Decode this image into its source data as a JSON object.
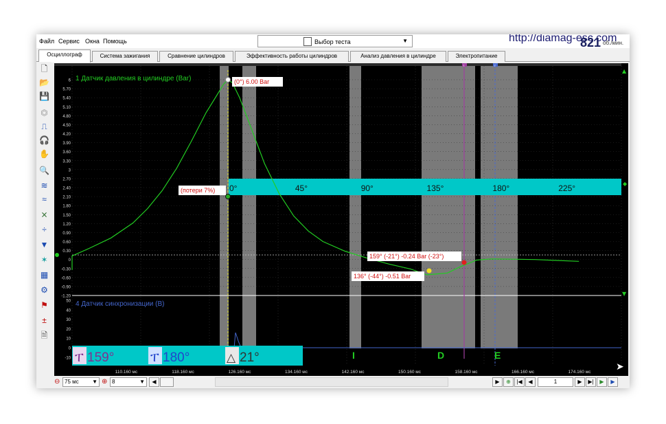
{
  "menu": {
    "file": "Файл",
    "service": "Сервис",
    "windows": "Окна",
    "help": "Помощь"
  },
  "test_selector": {
    "label": "Выбор теста"
  },
  "header": {
    "url": "http://diamag-esc.com",
    "rpm": "821",
    "rpm_unit": "об./мин."
  },
  "tabs": [
    {
      "label": "Осциллограф",
      "active": true
    },
    {
      "label": "Система зажигания"
    },
    {
      "label": "Сравнение цилиндров"
    },
    {
      "label": "Эффективность работы цилиндров"
    },
    {
      "label": "Анализ давления в цилиндре"
    },
    {
      "label": "Электропитание"
    }
  ],
  "toolbar_icons": [
    "new-file-icon",
    "open-folder-icon",
    "save-icon",
    "auto-icon",
    "trigger-icon",
    "headphones-icon",
    "hand-icon",
    "zoom-icon",
    "channels-icon",
    "channel-overlay-icon",
    "expand-icon",
    "compress-icon",
    "filter-icon",
    "colors-icon",
    "grid-icon",
    "auto-setup-icon",
    "flag-icon",
    "zero-icon",
    "document-icon"
  ],
  "channel1": {
    "label": "1 Датчик давления в цилиндре (Bar)",
    "color": "#22cc22",
    "ticks": [
      "6",
      "5.70",
      "5.40",
      "5.10",
      "4.80",
      "4.50",
      "4.20",
      "3.90",
      "3.60",
      "3.30",
      "3",
      "2.70",
      "2.40",
      "2.10",
      "1.80",
      "1.50",
      "1.20",
      "0.90",
      "0.60",
      "0.30",
      "0",
      "-0.30",
      "-0.60",
      "-0.90",
      "-1.20"
    ],
    "ylim": [
      -1.2,
      6
    ]
  },
  "channel4": {
    "label": "4 Датчик синхронизации (В)",
    "color": "#4466cc",
    "ticks": [
      "50",
      "40",
      "30",
      "20",
      "10",
      "0",
      "-10"
    ]
  },
  "angle_band": {
    "labels": [
      "0°",
      "45°",
      "90°",
      "135°",
      "180°",
      "225°"
    ],
    "color": "#00c8c8"
  },
  "annotations": {
    "peak": "(0°) 6.00 Bar",
    "loss": "(потери 7%)",
    "cursor_red": "159° (-21°) -0.24 Bar (-23°)",
    "cursor_yellow": "136° (-44°) -0.51 Bar"
  },
  "cursor_markers": {
    "c1": "1",
    "c2": "2"
  },
  "readouts": {
    "c1": "159°",
    "c2": "180°",
    "delta": "21°"
  },
  "phase_letters": [
    "I",
    "D",
    "E"
  ],
  "time_axis": [
    "110.160 мс",
    "118.160 мс",
    "126.160 мс",
    "134.160 мс",
    "142.160 мс",
    "150.160 мс",
    "158.160 мс",
    "166.160 мс",
    "174.160 мс"
  ],
  "bottom": {
    "timebase": "75 мс",
    "channel_sel": "8",
    "page": "1"
  },
  "chart_data": {
    "type": "line",
    "series": [
      {
        "name": "1 Датчик давления в цилиндре (Bar)",
        "x": [
          -200,
          -185,
          -170,
          -155,
          -140,
          -125,
          -110,
          -95,
          -80,
          -65,
          -55,
          -45,
          -35,
          -25,
          -15,
          -8,
          -3,
          0,
          3,
          8,
          15,
          25,
          35,
          45,
          55,
          65,
          80,
          95,
          110,
          125,
          136,
          150,
          159,
          170,
          180,
          195,
          210,
          225,
          240
        ],
        "y": [
          -0.35,
          -0.34,
          -0.3,
          -0.25,
          -0.17,
          -0.05,
          0.12,
          0.37,
          0.72,
          1.22,
          1.7,
          2.3,
          3.05,
          3.95,
          4.9,
          5.45,
          5.85,
          6.0,
          5.9,
          5.4,
          4.5,
          3.2,
          2.2,
          1.45,
          0.95,
          0.6,
          0.28,
          0.05,
          -0.15,
          -0.32,
          -0.51,
          -0.45,
          -0.24,
          -0.02,
          0.02,
          0.01,
          0.0,
          -0.03,
          -0.06
        ]
      },
      {
        "name": "4 Датчик синхронизации (В)"
      }
    ],
    "xlabel": "",
    "ylabel": "",
    "ylim": [
      -1.2,
      6
    ]
  }
}
